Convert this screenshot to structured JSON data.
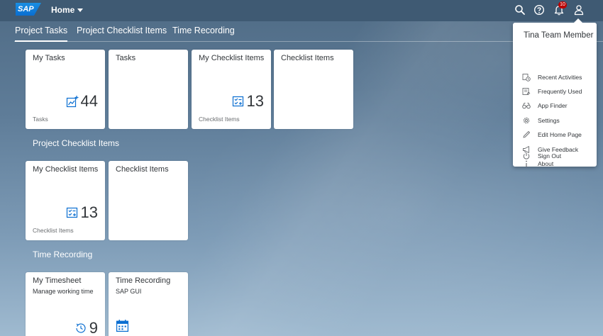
{
  "header": {
    "logo_text": "SAP",
    "home_label": "Home",
    "notification_count": "10"
  },
  "anchors": [
    {
      "label": "Project Tasks"
    },
    {
      "label": "Project Checklist Items"
    },
    {
      "label": "Time Recording"
    }
  ],
  "groups": [
    {
      "title": "",
      "tiles": [
        {
          "title": "My Tasks",
          "kpi": "44",
          "footer": "Tasks",
          "icon": "task-chart-icon"
        },
        {
          "title": "Tasks"
        },
        {
          "title": "My Checklist Items",
          "kpi": "13",
          "footer": "Checklist Items",
          "icon": "checklist-icon"
        },
        {
          "title": "Checklist Items"
        }
      ]
    },
    {
      "title": "Project Checklist Items",
      "tiles": [
        {
          "title": "My Checklist Items",
          "kpi": "13",
          "footer": "Checklist Items",
          "icon": "checklist-icon"
        },
        {
          "title": "Checklist Items"
        }
      ]
    },
    {
      "title": "Time Recording",
      "tiles": [
        {
          "title": "My Timesheet",
          "subtitle": "Manage working time",
          "kpi": "9",
          "icon": "clock-history-icon"
        },
        {
          "title": "Time Recording",
          "subtitle": "SAP GUI",
          "icon": "calendar-icon"
        }
      ]
    }
  ],
  "user_menu": {
    "name": "Tina Team Member",
    "items": [
      {
        "label": "Recent Activities",
        "icon": "recent-activities-icon"
      },
      {
        "label": "Frequently Used",
        "icon": "frequently-used-icon"
      },
      {
        "label": "App Finder",
        "icon": "binoculars-icon"
      },
      {
        "label": "Settings",
        "icon": "gear-icon"
      },
      {
        "label": "Edit Home Page",
        "icon": "pencil-icon"
      },
      {
        "label": "Give Feedback",
        "icon": "megaphone-icon"
      },
      {
        "label": "About",
        "icon": "info-icon"
      },
      {
        "label": "Sign Out",
        "icon": "power-icon"
      }
    ]
  },
  "colors": {
    "shell": "#3f5a73",
    "brand": "#0a6ed1",
    "badge": "#bb0000",
    "icon_blue": "#0a6ed1"
  }
}
